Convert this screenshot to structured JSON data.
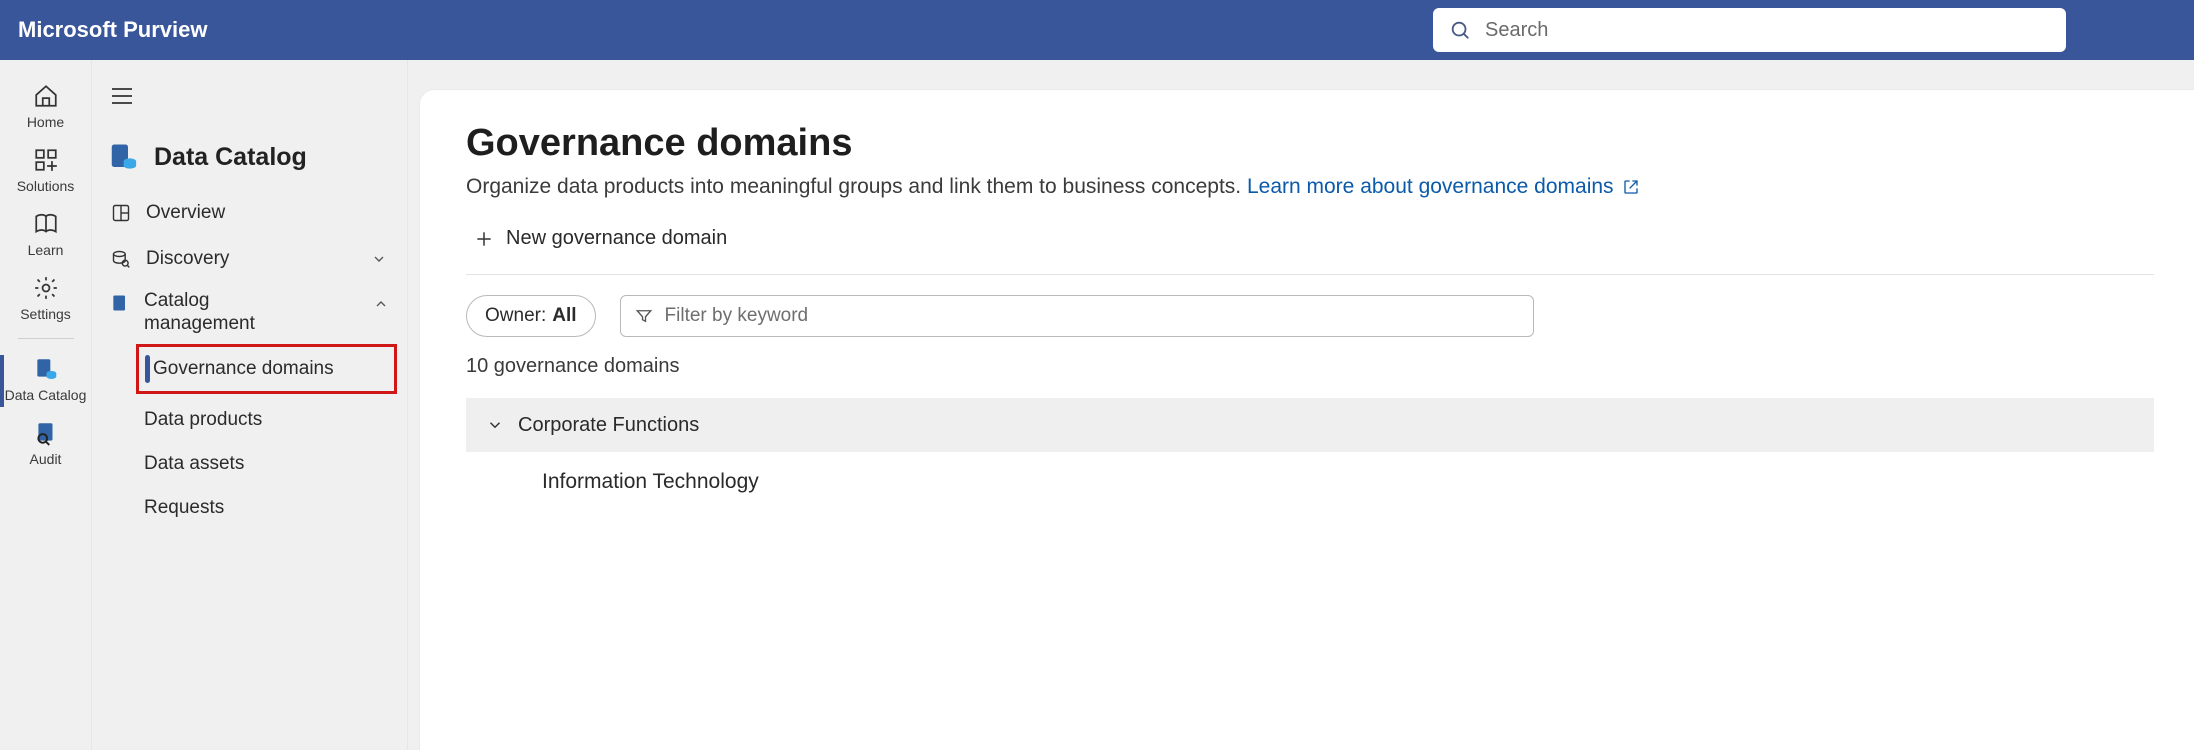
{
  "brand": "Microsoft Purview",
  "search": {
    "placeholder": "Search"
  },
  "rail": {
    "items": [
      {
        "label": "Home"
      },
      {
        "label": "Solutions"
      },
      {
        "label": "Learn"
      },
      {
        "label": "Settings"
      },
      {
        "label": "Data Catalog"
      },
      {
        "label": "Audit"
      }
    ]
  },
  "sidebar": {
    "title": "Data Catalog",
    "overview": "Overview",
    "discovery": "Discovery",
    "catalog_mgmt_l1": "Catalog",
    "catalog_mgmt_l2": "management",
    "gov_domains": "Governance domains",
    "data_products": "Data products",
    "data_assets": "Data assets",
    "requests": "Requests"
  },
  "main": {
    "title": "Governance domains",
    "subtitle_text": "Organize data products into meaningful groups and link them to business concepts. ",
    "learn_link": "Learn more about governance domains",
    "new_button": "New governance domain",
    "owner_label": "Owner: ",
    "owner_value": "All",
    "filter_placeholder": "Filter by keyword",
    "count_text": "10 governance domains",
    "domain_group": "Corporate Functions",
    "domain_child": "Information Technology"
  }
}
